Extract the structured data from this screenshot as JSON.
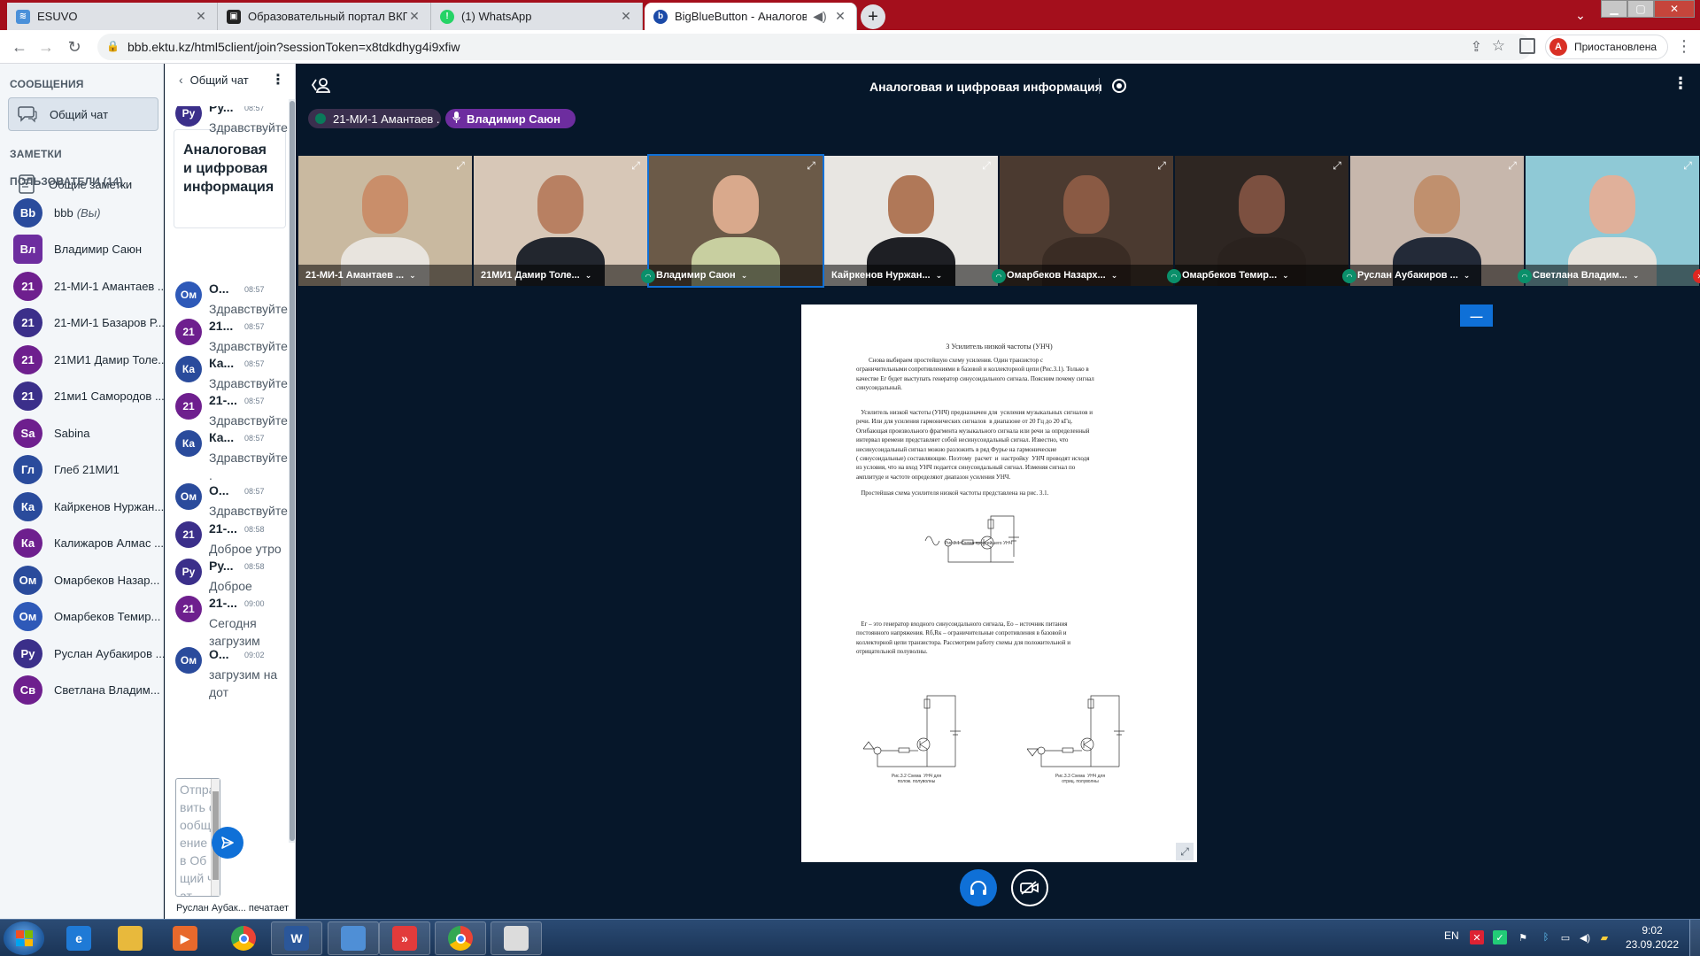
{
  "browser": {
    "tabs": [
      {
        "title": "ESUVO",
        "active": false
      },
      {
        "title": "Образовательный портал ВКГТУ",
        "active": false
      },
      {
        "title": "(1) WhatsApp",
        "active": false
      },
      {
        "title": "BigBlueButton - Аналоговая",
        "active": true
      }
    ],
    "new_tab": "+",
    "url": "bbb.ektu.kz/html5client/join?sessionToken=x8tdkdhyg4i9xfiw",
    "profile_initial": "А",
    "profile_status": "Приостановлена"
  },
  "left_panel": {
    "messages_heading": "СООБЩЕНИЯ",
    "public_chat": "Общий чат",
    "notes_heading": "ЗАМЕТКИ",
    "shared_notes": "Общие заметки",
    "users_heading": "ПОЛЬЗОВАТЕЛИ (14)",
    "users": [
      {
        "initials": "Bb",
        "name": "bbb",
        "suffix": "(Вы)",
        "color": "#2a4b9c",
        "status": "listen",
        "me": true
      },
      {
        "initials": "Вл",
        "name": "Владимир Саюн",
        "suffix": "",
        "color": "#6d2d9f",
        "status": "none",
        "me": true
      },
      {
        "initials": "21",
        "name": "21-МИ-1 Амантаев ...",
        "suffix": "",
        "color": "#6e1f8e",
        "status": "listen",
        "me": false
      },
      {
        "initials": "21",
        "name": "21-МИ-1 Базаров Р...",
        "suffix": "",
        "color": "#3b2f8a",
        "status": "listen",
        "me": false
      },
      {
        "initials": "21",
        "name": "21МИ1 Дамир Толе...",
        "suffix": "",
        "color": "#6e1f8e",
        "status": "listen",
        "me": false
      },
      {
        "initials": "21",
        "name": "21ми1 Самородов ...",
        "suffix": "",
        "color": "#3b2f8a",
        "status": "muted",
        "me": false
      },
      {
        "initials": "Sa",
        "name": "Sabina",
        "suffix": "",
        "color": "#6e1f8e",
        "status": "listen",
        "me": false
      },
      {
        "initials": "Гл",
        "name": "Глеб 21МИ1",
        "suffix": "",
        "color": "#2a4b9c",
        "status": "listen",
        "me": false
      },
      {
        "initials": "Ка",
        "name": "Кайркенов Нуржан...",
        "suffix": "",
        "color": "#2a4b9c",
        "status": "listen",
        "me": false
      },
      {
        "initials": "Ка",
        "name": "Калижаров Алмас ...",
        "suffix": "",
        "color": "#6e1f8e",
        "status": "muted",
        "me": false
      },
      {
        "initials": "Ом",
        "name": "Омарбеков Назар...",
        "suffix": "",
        "color": "#2a4b9c",
        "status": "listen",
        "me": false
      },
      {
        "initials": "Ом",
        "name": "Омарбеков Темир...",
        "suffix": "",
        "color": "#2e59b8",
        "status": "listen",
        "me": false
      },
      {
        "initials": "Ру",
        "name": "Руслан Аубакиров ...",
        "suffix": "",
        "color": "#3b2f8a",
        "status": "listen",
        "me": false
      },
      {
        "initials": "Св",
        "name": "Светлана Владим...",
        "suffix": "",
        "color": "#6e1f8e",
        "status": "muted",
        "me": false
      }
    ]
  },
  "chat": {
    "title": "Общий чат",
    "pinned": "Аналоговая и цифровая информация",
    "messages": [
      {
        "initials": "Ру",
        "name": "Ру...",
        "time": "08:57",
        "text": "Здравствуйте",
        "color": "#3b2f8a"
      },
      {
        "initials": "Ом",
        "name": "О...",
        "time": "08:57",
        "text": "Здравствуйте",
        "color": "#2e59b8"
      },
      {
        "initials": "21",
        "name": "21...",
        "time": "08:57",
        "text": "Здравствуйте",
        "color": "#6e1f8e"
      },
      {
        "initials": "Ка",
        "name": "Ка...",
        "time": "08:57",
        "text": "Здравствуйте",
        "color": "#2a4b9c"
      },
      {
        "initials": "21",
        "name": "21-...",
        "time": "08:57",
        "text": "Здравствуйте",
        "color": "#6e1f8e"
      },
      {
        "initials": "Ка",
        "name": "Ка...",
        "time": "08:57",
        "text": "Здравствуйте .",
        "color": "#2a4b9c"
      },
      {
        "initials": "Ом",
        "name": "О...",
        "time": "08:57",
        "text": "Здравствуйте",
        "color": "#2a4b9c"
      },
      {
        "initials": "21",
        "name": "21-...",
        "time": "08:58",
        "text": "Доброе утро",
        "color": "#3b2f8a"
      },
      {
        "initials": "Ру",
        "name": "Ру...",
        "time": "08:58",
        "text": "Доброе",
        "color": "#3b2f8a"
      },
      {
        "initials": "21",
        "name": "21-...",
        "time": "09:00",
        "text": "Сегодня загрузим",
        "color": "#6e1f8e"
      },
      {
        "initials": "Ом",
        "name": "О...",
        "time": "09:02",
        "text": "загрузим на дот",
        "color": "#2a4b9c"
      }
    ],
    "input_placeholder": "Отправить сообщение в Общий чат",
    "typing": "Руслан Аубак...   печатает"
  },
  "main": {
    "meeting_title": "Аналоговая и цифровая информация",
    "talking": [
      {
        "name": "21-МИ-1 Амантаев ...",
        "bg": "#3a2f4e",
        "dot": "#0a7a5a"
      },
      {
        "name": "Владимир Саюн",
        "bg": "#6d2d9f",
        "dot": "#4b7de0"
      }
    ],
    "videos": [
      {
        "name": "21-МИ-1 Амантаев ...",
        "status": "none",
        "bg": "#c9b9a0",
        "skin": "#c98e6a",
        "shirt": "#e8e4de",
        "active": false
      },
      {
        "name": "21МИ1 Дамир Толе...",
        "status": "none",
        "bg": "#d7c7b7",
        "skin": "#b88062",
        "shirt": "#22262e",
        "active": false
      },
      {
        "name": "Владимир Саюн",
        "status": "listen",
        "bg": "#6b5a48",
        "skin": "#d9a98c",
        "shirt": "#c8cfa0",
        "active": true
      },
      {
        "name": "Кайркенов Нуржан...",
        "status": "none",
        "bg": "#e8e6e2",
        "skin": "#b07858",
        "shirt": "#1e1f24",
        "active": false
      },
      {
        "name": "Омарбеков Назарх...",
        "status": "listen",
        "bg": "#4b3a30",
        "skin": "#8a5a44",
        "shirt": "#3a2c24",
        "active": false
      },
      {
        "name": "Омарбеков Темир...",
        "status": "listen",
        "bg": "#2e2622",
        "skin": "#7c5040",
        "shirt": "#2a221e",
        "active": false
      },
      {
        "name": "Руслан Аубакиров ...",
        "status": "listen",
        "bg": "#c7b7ac",
        "skin": "#c0906e",
        "shirt": "#232a38",
        "active": false
      },
      {
        "name": "Светлана Владим...",
        "status": "listen",
        "bg": "#8fc9d6",
        "skin": "#e0b09a",
        "shirt": "#e7e3dc",
        "active": false
      }
    ],
    "last_video_status": "muted",
    "slide": {
      "title": "3 Усилитель низкой частоты (УНЧ)",
      "p1": "        Снова выбираем простейшую схему усиления. Один транзистор с\nограничительными сопротивлениями в базовой и коллекторной цепи (Рис.3.1). Только в\nкачестве Ег будет выступать генератор синусоидального сигнала. Поясним почему сигнал\nсинусоидальный.",
      "p2": "   Усилитель низкой частоты (УНЧ) предназначен для  усиления музыкальных сигналов и\nречи. Или для усиления гармонических сигналов  в диапазоне от 20 Гц до 20 кГц.\nОгибающая произвольного фрагмента музыкального сигнала или речи за определенный\nинтервал времени представляет собой несинусоидальный сигнал. Известно, что\nнесинусоидальный сигнал можно разложить в ряд Фурье на гармонические\n( синусоидальные) составляющие. Поэтому  расчет  и  настройку  УНЧ проводят исходя\nиз условия, что на вход УНЧ подается синусоидальный сигнал. Изменяя сигнал по\nамплитуде и частоте определяют диапазон усиления УНЧ.",
      "p3": "   Простейшая схема усилителя низкой частоты представлена на рис. 3.1.",
      "cap1": "Рис.3.1 Схема простейшего УНЧ",
      "p4": "   Ег – это генератор входного синусоидального сигнала, Ео – источник питания\nпостоянного напряжения. Rб,Rк – ограничительные сопротивления в базовой и\nколлекторной цепи транзистора. Рассмотрим работу схемы для положительной и\nотрицательной полуволны.",
      "cap2": "Рис.3.2 Схема  УНЧ для\nполож. полуволны",
      "cap3": "Рис.3.3 Схема  УНЧ для\nотриц. полуволны"
    }
  },
  "taskbar": {
    "apps": [
      {
        "name": "ie",
        "label": "e",
        "color": "#1f7ad6",
        "open": false
      },
      {
        "name": "explorer",
        "label": "",
        "color": "#e8b93c",
        "open": false
      },
      {
        "name": "media",
        "label": "▶",
        "color": "#e8692c",
        "open": false
      },
      {
        "name": "chrome",
        "label": "",
        "color": "#34a853",
        "open": false
      },
      {
        "name": "word",
        "label": "W",
        "color": "#2b579a",
        "open": true
      },
      {
        "name": "presentation",
        "label": "",
        "color": "#4f8fd6",
        "open": true
      },
      {
        "name": "anydesk",
        "label": "»",
        "color": "#e23b3b",
        "open": true
      },
      {
        "name": "chrome-profile",
        "label": "",
        "color": "#34a853",
        "open": true
      },
      {
        "name": "calculator",
        "label": "",
        "color": "#dcdcdc",
        "open": true
      }
    ],
    "lang": "EN",
    "time": "9:02",
    "date": "23.09.2022"
  }
}
